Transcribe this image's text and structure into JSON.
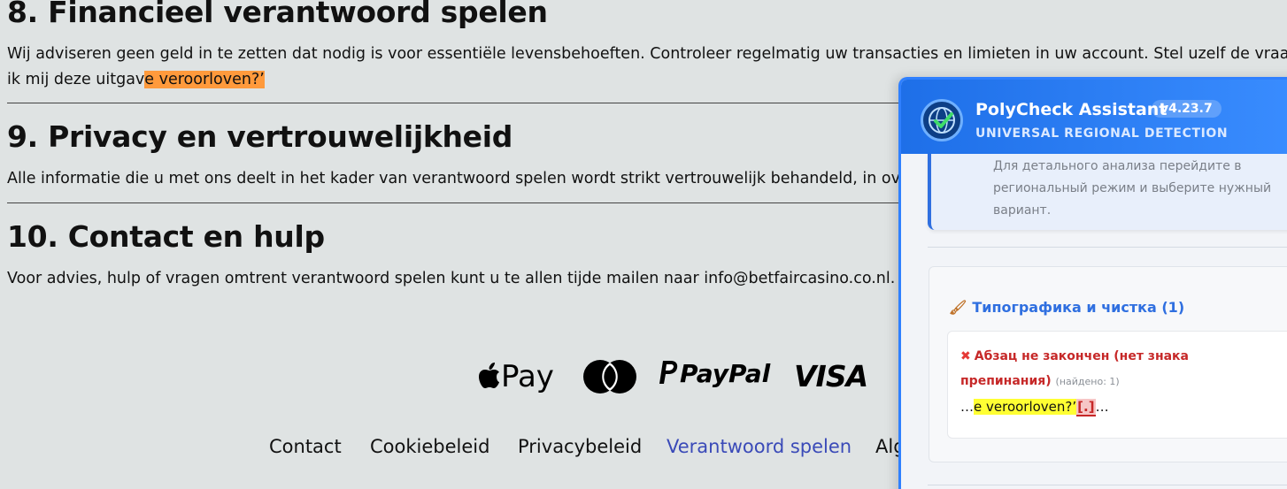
{
  "sections": [
    {
      "title": "8. Financieel verantwoord spelen",
      "body_line1": "Wij adviseren geen geld in te zetten dat nodig is voor essentiële levensbehoeften. Controleer regelmatig uw transacties en limieten in uw account. Stel uzelf de vraag",
      "body_line2_before": "ik mij deze uitgav",
      "body_line2_highlight": "e veroorloven?’"
    },
    {
      "title": "9. Privacy en vertrouwelijkheid",
      "body": "Alle informatie die u met ons deelt in het kader van verantwoord spelen wordt strikt vertrouwelijk behandeld, in ov"
    },
    {
      "title": "10. Contact en hulp",
      "body": "Voor advies, hulp of vragen omtrent verantwoord spelen kunt u te allen tijde mailen naar info@betfaircasino.co.nl."
    }
  ],
  "payments": {
    "apple": "Pay",
    "apple_icon": "apple-icon",
    "mastercard_icon": "mastercard-icon",
    "paypal": "PayPal",
    "paypal_icon": "paypal-icon",
    "visa": "VISA"
  },
  "footer_links": [
    "Contact",
    "Cookiebeleid",
    "Privacybeleid",
    "Verantwoord spelen",
    "Alg"
  ],
  "colors": {
    "page_background": "#dfe3e3",
    "highlight_orange": "#ff9a3c",
    "panel_accent": "#2f80ff",
    "active_link": "#3a4ab8",
    "issue_red": "#c62828",
    "highlight_yellow": "#ffff33"
  },
  "panel": {
    "title": "PolyCheck Assistant",
    "version": "v4.23.7",
    "subtitle": "UNIVERSAL REGIONAL DETECTION",
    "info_text": "Для детального анализа перейдите в региональный режим и выберите нужный вариант.",
    "section_heading": "Типографика и чистка (1)",
    "section_icon": "brush-icon",
    "issue": {
      "icon": "x-icon",
      "title": "Абзац не закончен (нет знака препинания)",
      "count": "(найдено: 1)",
      "snippet_prefix": "…",
      "snippet_highlight": "e veroorloven?’",
      "snippet_missing": "[.]",
      "snippet_suffix": "…"
    }
  }
}
